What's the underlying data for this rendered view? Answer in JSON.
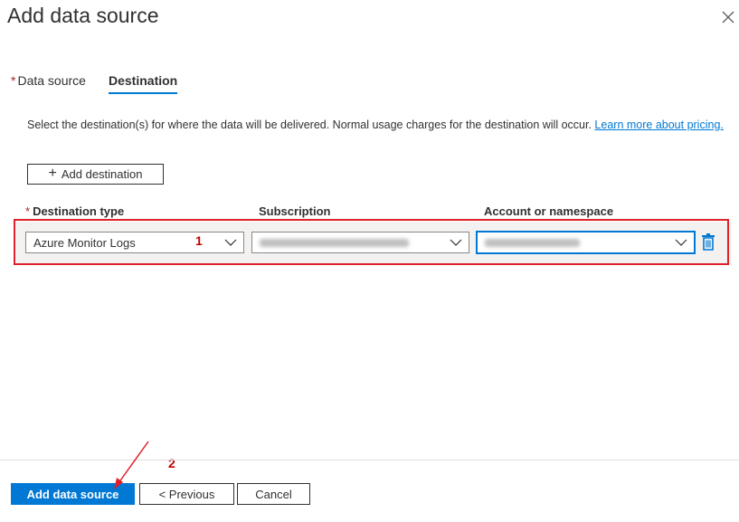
{
  "header": {
    "title": "Add data source"
  },
  "tabs": [
    {
      "label": "Data source",
      "required": "*",
      "active": false
    },
    {
      "label": "Destination",
      "active": true
    }
  ],
  "description": {
    "text": "Select the destination(s) for where the data will be delivered. Normal usage charges for the destination will occur. ",
    "link": "Learn more about pricing."
  },
  "add_destination": {
    "plus": "+",
    "label": "Add destination"
  },
  "columns": {
    "required": "*",
    "destination_type": "Destination type",
    "subscription": "Subscription",
    "account": "Account or namespace"
  },
  "row": {
    "destination_type_value": "Azure Monitor Logs"
  },
  "annotations": {
    "one": "1",
    "two": "2"
  },
  "footer": {
    "add_label": "Add data source",
    "previous_label": "< Previous",
    "cancel_label": "Cancel"
  },
  "colors": {
    "accent": "#0078d4",
    "highlight": "#e0202a",
    "annotation": "#c00000",
    "required": "#a4262c"
  },
  "icons": [
    "close-icon",
    "plus-icon",
    "chevron-down-icon",
    "trash-icon",
    "arrow-annotation"
  ]
}
